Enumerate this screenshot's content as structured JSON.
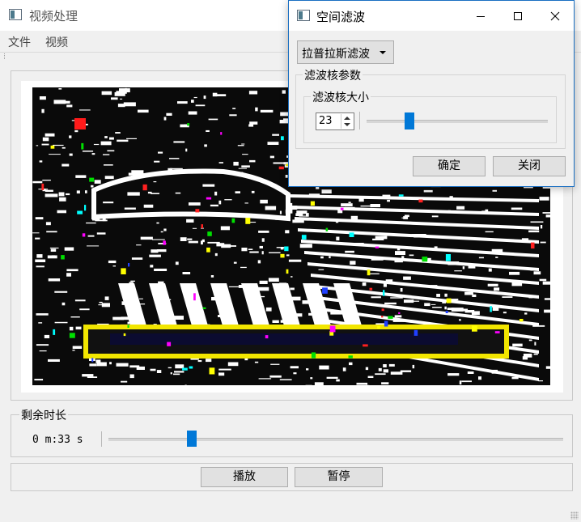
{
  "main_window": {
    "title": "视频处理",
    "menu": [
      "文件",
      "视频"
    ]
  },
  "remaining": {
    "group_title": "剩余时长",
    "time_text": "0 m:33 s",
    "slider_position": 0.17
  },
  "controls": {
    "play_label": "播放",
    "pause_label": "暂停"
  },
  "dialog": {
    "title": "空间滤波",
    "filter_type": {
      "selected": "拉普拉斯滤波"
    },
    "kernel_params_title": "滤波核参数",
    "kernel_size_title": "滤波核大小",
    "kernel_size_value": "23",
    "kernel_slider_position": 0.22,
    "ok_label": "确定",
    "close_label": "关闭"
  },
  "icons": [
    "app-icon",
    "minimize-icon",
    "maximize-icon",
    "close-icon",
    "dropdown-arrow-icon",
    "spin-up-icon",
    "spin-down-icon",
    "resize-grip-icon"
  ],
  "colors": {
    "accent": "#0078d7",
    "dialog_border": "#1a6fc2",
    "window_bg": "#f0f0f0"
  }
}
